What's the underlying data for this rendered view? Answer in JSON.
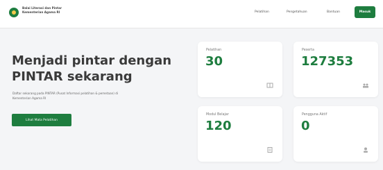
{
  "brand": {
    "line1": "Balai Literasi dan Pintar",
    "line2": "Kementerian Agama RI"
  },
  "nav": {
    "links": [
      "Pelatihan",
      "Pengetahuan",
      "Bantuan"
    ],
    "login_label": "Masuk"
  },
  "hero": {
    "title_line1": "Menjadi pintar dengan",
    "title_line2": "PINTAR sekarang",
    "description": "Daftar sekarang pada PINTAR (Pusat Informasi pelatihan & pemetaan) di Kementerian Agama RI",
    "cta_label": "Lihat Mata Pelatihan"
  },
  "stats": [
    {
      "label": "Pelatihan",
      "value": "30",
      "icon": "book-icon"
    },
    {
      "label": "Peserta",
      "value": "127353",
      "icon": "users-icon"
    },
    {
      "label": "Modul Belajar",
      "value": "120",
      "icon": "module-icon"
    },
    {
      "label": "Pengguna Aktif",
      "value": "0",
      "icon": "user-icon"
    }
  ],
  "colors": {
    "accent": "#1e7d3f",
    "background": "#f4f5f7"
  }
}
